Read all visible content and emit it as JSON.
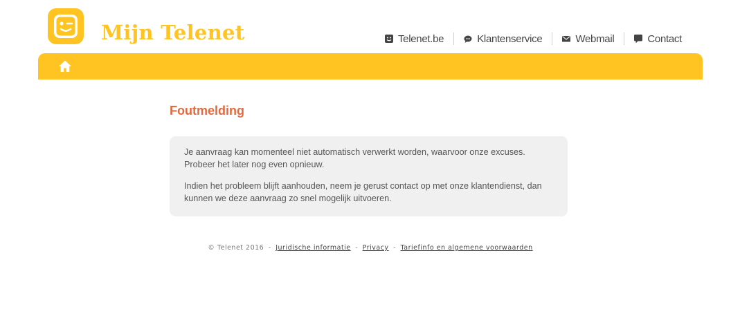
{
  "header": {
    "brand": "Mijn Telenet",
    "logo_icon": "telenet-smiley-logo",
    "nav": [
      {
        "label": "Telenet.be",
        "icon": "smiley-icon"
      },
      {
        "label": "Klantenservice",
        "icon": "chat-bubble-icon"
      },
      {
        "label": "Webmail",
        "icon": "envelope-icon"
      },
      {
        "label": "Contact",
        "icon": "speech-bubble-icon"
      }
    ]
  },
  "menubar": {
    "home_icon": "home-icon"
  },
  "main": {
    "title": "Foutmelding",
    "message": {
      "paragraph1": "Je aanvraag kan momenteel niet automatisch verwerkt worden, waarvoor onze excuses. Probeer het later nog even opnieuw.",
      "paragraph2": "Indien het probleem blijft aanhouden, neem je gerust contact op met onze klantendienst, dan kunnen we deze aanvraag zo snel mogelijk uitvoeren."
    }
  },
  "footer": {
    "copyright": "© Telenet 2016",
    "separator": "-",
    "links": [
      "Juridische informatie",
      "Privacy",
      "Tariefinfo en algemene voorwaarden"
    ]
  },
  "colors": {
    "brand_yellow": "#ffc421",
    "title_orange": "#e3683d",
    "box_gray": "#f0f0f0"
  }
}
